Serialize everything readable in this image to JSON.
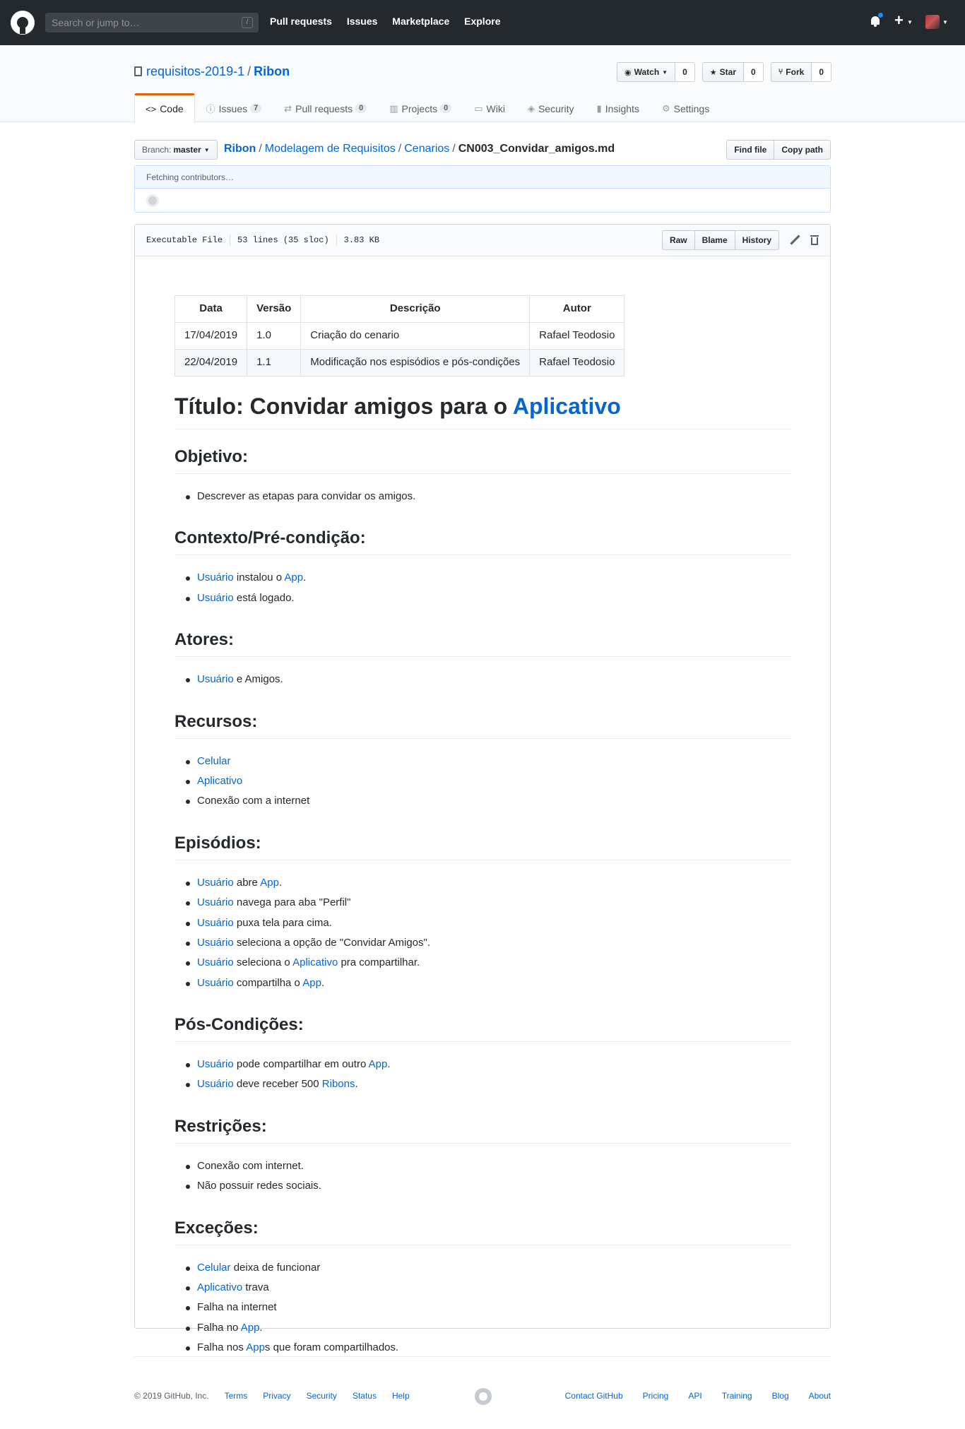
{
  "header": {
    "search_placeholder": "Search or jump to…",
    "search_shortcut": "/",
    "nav": [
      "Pull requests",
      "Issues",
      "Marketplace",
      "Explore"
    ]
  },
  "repo": {
    "owner": "requisitos-2019-1",
    "separator": "/",
    "name": "Ribon",
    "actions": {
      "watch_label": "Watch",
      "watch_count": "0",
      "star_label": "Star",
      "star_count": "0",
      "fork_label": "Fork",
      "fork_count": "0"
    },
    "tabs": [
      {
        "label": "Code",
        "icon": "code-icon"
      },
      {
        "label": "Issues",
        "count": "7",
        "icon": "issue-icon"
      },
      {
        "label": "Pull requests",
        "count": "0",
        "icon": "pull-request-icon"
      },
      {
        "label": "Projects",
        "count": "0",
        "icon": "project-icon"
      },
      {
        "label": "Wiki",
        "icon": "book-icon"
      },
      {
        "label": "Security",
        "icon": "shield-icon"
      },
      {
        "label": "Insights",
        "icon": "graph-icon"
      },
      {
        "label": "Settings",
        "icon": "gear-icon"
      }
    ]
  },
  "file_nav": {
    "branch_prefix": "Branch:",
    "branch": "master",
    "breadcrumb": [
      "Ribon",
      "Modelagem de Requisitos",
      "Cenarios"
    ],
    "filename": "CN003_Convidar_amigos.md",
    "find_file": "Find file",
    "copy_path": "Copy path"
  },
  "commit_tease": {
    "text": "Fetching contributors…"
  },
  "file": {
    "mode": "Executable File",
    "lines": "53 lines (35 sloc)",
    "size": "3.83 KB",
    "raw": "Raw",
    "blame": "Blame",
    "history": "History"
  },
  "markdown": {
    "table": {
      "headers": [
        "Data",
        "Versão",
        "Descrição",
        "Autor"
      ],
      "rows": [
        [
          "17/04/2019",
          "1.0",
          "Criação do cenario",
          "Rafael Teodosio"
        ],
        [
          "22/04/2019",
          "1.1",
          "Modificação nos espisódios e pós-condições",
          "Rafael Teodosio"
        ]
      ]
    },
    "title_text": "Título: Convidar amigos para o ",
    "title_link": "Aplicativo",
    "sections": [
      {
        "heading": "Objetivo:",
        "items": [
          [
            {
              "t": "Descrever as etapas para convidar os amigos."
            }
          ]
        ]
      },
      {
        "heading": "Contexto/Pré-condição:",
        "items": [
          [
            {
              "l": "Usuário"
            },
            {
              "t": " instalou o "
            },
            {
              "l": "App"
            },
            {
              "t": "."
            }
          ],
          [
            {
              "l": "Usuário"
            },
            {
              "t": " está logado."
            }
          ]
        ]
      },
      {
        "heading": "Atores:",
        "items": [
          [
            {
              "l": "Usuário"
            },
            {
              "t": " e Amigos."
            }
          ]
        ]
      },
      {
        "heading": "Recursos:",
        "items": [
          [
            {
              "l": "Celular"
            }
          ],
          [
            {
              "l": "Aplicativo"
            }
          ],
          [
            {
              "t": "Conexão com a internet"
            }
          ]
        ]
      },
      {
        "heading": "Episódios:",
        "items": [
          [
            {
              "l": "Usuário"
            },
            {
              "t": " abre "
            },
            {
              "l": "App"
            },
            {
              "t": "."
            }
          ],
          [
            {
              "l": "Usuário"
            },
            {
              "t": " navega para aba \"Perfil\""
            }
          ],
          [
            {
              "l": "Usuário"
            },
            {
              "t": " puxa tela para cima."
            }
          ],
          [
            {
              "l": "Usuário"
            },
            {
              "t": " seleciona a opção de \"Convidar Amigos\"."
            }
          ],
          [
            {
              "l": "Usuário"
            },
            {
              "t": " seleciona o "
            },
            {
              "l": "Aplicativo"
            },
            {
              "t": " pra compartilhar."
            }
          ],
          [
            {
              "l": "Usuário"
            },
            {
              "t": " compartilha o "
            },
            {
              "l": "App"
            },
            {
              "t": "."
            }
          ]
        ]
      },
      {
        "heading": "Pós-Condições:",
        "items": [
          [
            {
              "l": "Usuário"
            },
            {
              "t": " pode compartilhar em outro "
            },
            {
              "l": "App"
            },
            {
              "t": "."
            }
          ],
          [
            {
              "l": "Usuário"
            },
            {
              "t": " deve receber 500 "
            },
            {
              "l": "Ribons"
            },
            {
              "t": "."
            }
          ]
        ]
      },
      {
        "heading": "Restrições:",
        "items": [
          [
            {
              "t": "Conexão com internet."
            }
          ],
          [
            {
              "t": "Não possuir redes sociais."
            }
          ]
        ]
      },
      {
        "heading": "Exceções:",
        "items": [
          [
            {
              "l": "Celular"
            },
            {
              "t": " deixa de funcionar"
            }
          ],
          [
            {
              "l": "Aplicativo"
            },
            {
              "t": " trava"
            }
          ],
          [
            {
              "t": "Falha na internet"
            }
          ],
          [
            {
              "t": "Falha no "
            },
            {
              "l": "App"
            },
            {
              "t": "."
            }
          ],
          [
            {
              "t": "Falha nos "
            },
            {
              "l": "App"
            },
            {
              "t": "s que foram compartilhados."
            }
          ]
        ]
      }
    ]
  },
  "footer": {
    "copyright": "© 2019 GitHub, Inc.",
    "left_links": [
      "Terms",
      "Privacy",
      "Security",
      "Status",
      "Help"
    ],
    "right_links": [
      "Contact GitHub",
      "Pricing",
      "API",
      "Training",
      "Blog",
      "About"
    ]
  }
}
